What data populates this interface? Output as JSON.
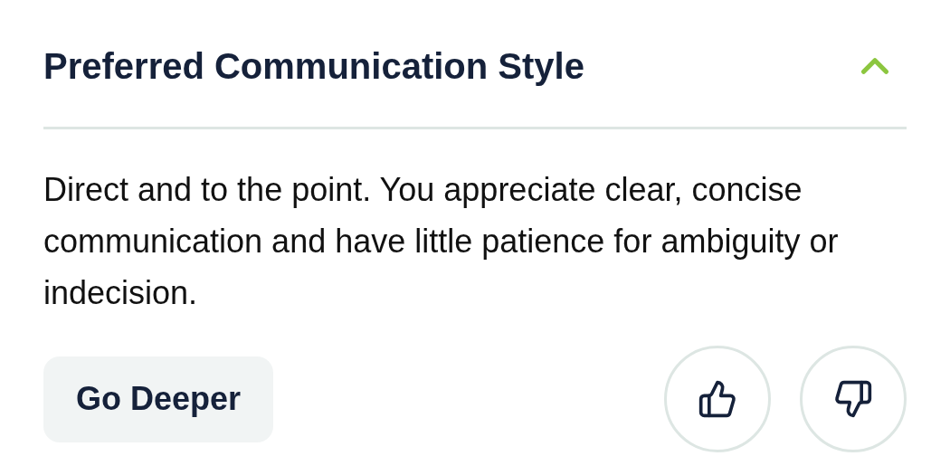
{
  "section": {
    "title": "Preferred Communication Style",
    "expanded": true,
    "description": "Direct and to the point. You appreciate clear, concise communication and have little patience for ambiguity or indecision.",
    "button": "Go Deeper"
  }
}
